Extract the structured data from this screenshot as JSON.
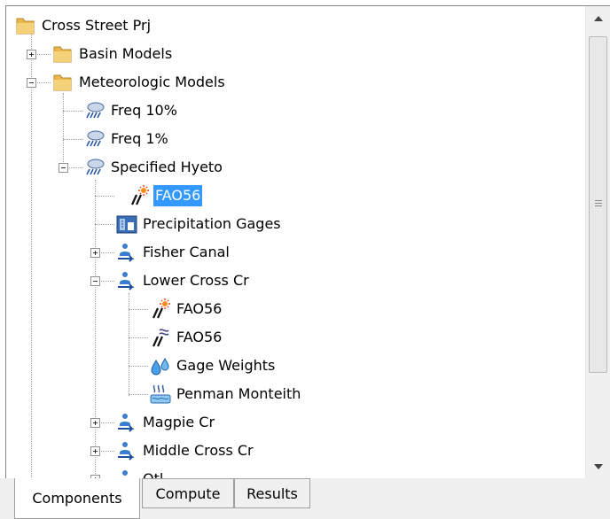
{
  "tree": {
    "root": {
      "label": "Cross Street Prj",
      "icon": "folder-icon"
    },
    "basin_models": {
      "label": "Basin Models",
      "icon": "folder-icon"
    },
    "met_models": {
      "label": "Meteorologic Models",
      "icon": "folder-icon"
    },
    "freq10": {
      "label": "Freq 10%",
      "icon": "met-model-icon"
    },
    "freq1": {
      "label": "Freq 1%",
      "icon": "met-model-icon"
    },
    "spec_hyeto": {
      "label": "Specified Hyeto",
      "icon": "met-model-icon"
    },
    "fao56_top": {
      "label": "FAO56",
      "icon": "evapotranspiration-icon",
      "selected": true
    },
    "precip_gages": {
      "label": "Precipitation Gages",
      "icon": "gage-icon"
    },
    "fisher_canal": {
      "label": "Fisher Canal",
      "icon": "subbasin-icon"
    },
    "lower_cross": {
      "label": "Lower Cross Cr",
      "icon": "subbasin-icon"
    },
    "fao56_a": {
      "label": "FAO56",
      "icon": "evapotranspiration-icon"
    },
    "fao56_b": {
      "label": "FAO56",
      "icon": "shortwave-radiation-icon"
    },
    "gage_weights": {
      "label": "Gage Weights",
      "icon": "water-drops-icon"
    },
    "penman": {
      "label": "Penman Monteith",
      "icon": "heat-waves-icon"
    },
    "magpie": {
      "label": "Magpie Cr",
      "icon": "subbasin-icon"
    },
    "middle_cross": {
      "label": "Middle Cross Cr",
      "icon": "subbasin-icon"
    },
    "otley": {
      "label": "Otl",
      "icon": "subbasin-icon"
    }
  },
  "tabs": {
    "components": "Components",
    "compute": "Compute",
    "results": "Results",
    "active": "Components"
  },
  "colors": {
    "selection": "#3399ff",
    "folder": "#e8b94a"
  }
}
